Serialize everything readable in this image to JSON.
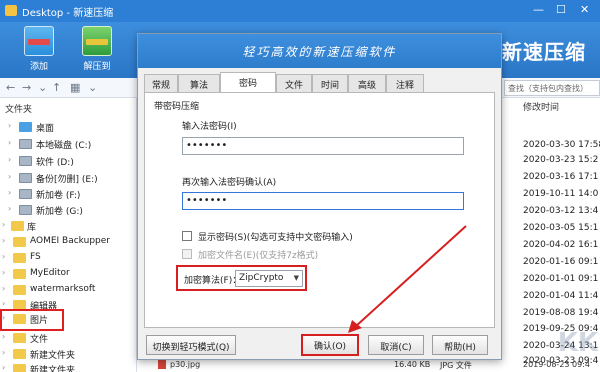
{
  "window": {
    "title": "Desktop - 新速压缩"
  },
  "toolbar": {
    "add_label": "添加",
    "extract_label": "解压到",
    "brand": "新速压缩"
  },
  "address": {
    "search_placeholder": "查找（支持包内查找）"
  },
  "folders": {
    "header": "文件夹",
    "items": [
      {
        "label": "桌面",
        "icon": "desktop-icon"
      },
      {
        "label": "本地磁盘 (C:)",
        "icon": "drive-icon"
      },
      {
        "label": "软件 (D:)",
        "icon": "drive-icon"
      },
      {
        "label": "备份[勿删] (E:)",
        "icon": "drive-icon"
      },
      {
        "label": "新加卷 (F:)",
        "icon": "drive-icon"
      },
      {
        "label": "新加卷 (G:)",
        "icon": "drive-icon"
      },
      {
        "label": "库",
        "icon": "library-icon"
      },
      {
        "label": "AOMEI Backupper",
        "icon": "folder-icon"
      },
      {
        "label": "FS",
        "icon": "folder-icon"
      },
      {
        "label": "MyEditor",
        "icon": "folder-icon"
      },
      {
        "label": "watermarksoft",
        "icon": "folder-icon"
      },
      {
        "label": "编辑器",
        "icon": "folder-icon"
      },
      {
        "label": "图片",
        "icon": "folder-icon"
      },
      {
        "label": "文件",
        "icon": "folder-icon"
      },
      {
        "label": "新建文件夹",
        "icon": "folder-icon"
      },
      {
        "label": "新建文件夹",
        "icon": "folder-icon"
      }
    ]
  },
  "list": {
    "modified_header": "修改时间",
    "dates": [
      "2020-03-30 17:58",
      "2020-03-23 15:2",
      "2020-03-16 17:1",
      "2019-10-11 14:0",
      "2020-03-12 13:4",
      "2020-03-05 15:1",
      "2020-04-02 16:1",
      "2020-01-16 09:1",
      "2020-01-01 09:1",
      "2020-01-04 11:4",
      "2019-08-08 19:4",
      "2019-09-25 09:4",
      "2020-03-24 13:1",
      "2020-03-23 09:4",
      "2019-08-23 09:4"
    ],
    "bottom_file": {
      "name": "p30.jpg",
      "size": "16.40 KB",
      "type": "JPG 文件"
    }
  },
  "dialog": {
    "title": "轻巧高效的新速压缩软件",
    "tabs": [
      "常规",
      "算法",
      "密码",
      "文件",
      "时间",
      "高级",
      "注释"
    ],
    "active_tab": "密码",
    "group_label": "带密码压缩",
    "password_label": "输入法密码(I)",
    "password_value": "•••••••",
    "confirm_label": "再次输入法密码确认(A)",
    "confirm_value": "•••••••",
    "show_password_label": "显示密码(S)(勾选可支持中文密码输入)",
    "encrypt_names_label": "加密文件名(E)(仅支持7z格式)",
    "encryption_label": "加密算法(F)：",
    "encryption_value": "ZipCrypto",
    "switch_mode_button": "切换到轻巧模式(Q)",
    "ok_button": "确认(O)",
    "cancel_button": "取消(C)",
    "help_button": "帮助(H)"
  },
  "accent": {
    "primary": "#2c7fd4",
    "highlight": "#d62020"
  }
}
